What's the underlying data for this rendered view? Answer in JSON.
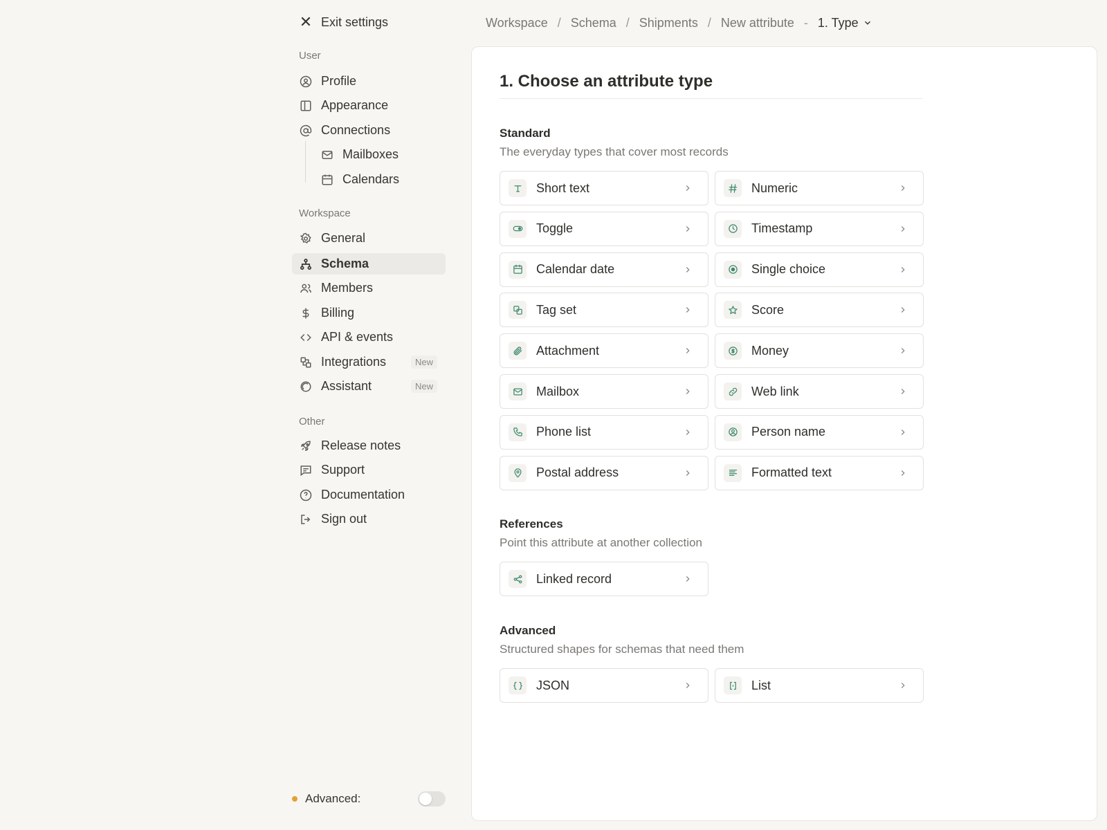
{
  "sidebar": {
    "exit_label": "Exit settings",
    "user_section": "User",
    "workspace_section": "Workspace",
    "other_section": "Other",
    "user_items": [
      {
        "label": "Profile",
        "icon": "user-circle-icon"
      },
      {
        "label": "Appearance",
        "icon": "layout-icon"
      },
      {
        "label": "Connections",
        "icon": "at-sign-icon"
      },
      {
        "label": "Mailboxes",
        "icon": "mail-icon"
      },
      {
        "label": "Calendars",
        "icon": "calendar-icon"
      }
    ],
    "workspace_items": [
      {
        "label": "General",
        "icon": "gear-icon"
      },
      {
        "label": "Schema",
        "icon": "schema-icon",
        "active": true
      },
      {
        "label": "Members",
        "icon": "users-icon"
      },
      {
        "label": "Billing",
        "icon": "dollar-icon"
      },
      {
        "label": "API & events",
        "icon": "code-icon"
      },
      {
        "label": "Integrations",
        "icon": "integrations-icon",
        "badge": "New"
      },
      {
        "label": "Assistant",
        "icon": "assistant-icon",
        "badge": "New"
      }
    ],
    "other_items": [
      {
        "label": "Release notes",
        "icon": "rocket-icon"
      },
      {
        "label": "Support",
        "icon": "message-icon"
      },
      {
        "label": "Documentation",
        "icon": "help-circle-icon"
      },
      {
        "label": "Sign out",
        "icon": "sign-out-icon"
      }
    ],
    "advanced_label": "Advanced:",
    "advanced_enabled": false,
    "advanced_dot_color": "#e3a237"
  },
  "breadcrumb": {
    "items": [
      "Workspace",
      "Schema",
      "Shipments",
      "New attribute"
    ],
    "current": "1. Type"
  },
  "main": {
    "title": "1. Choose an attribute type",
    "standard": {
      "title": "Standard",
      "subtitle": "The everyday types that cover most records",
      "types": [
        {
          "label": "Short text",
          "icon": "text-icon"
        },
        {
          "label": "Numeric",
          "icon": "hash-icon"
        },
        {
          "label": "Toggle",
          "icon": "toggle-icon"
        },
        {
          "label": "Timestamp",
          "icon": "clock-icon"
        },
        {
          "label": "Calendar date",
          "icon": "calendar-icon"
        },
        {
          "label": "Single choice",
          "icon": "radio-icon"
        },
        {
          "label": "Tag set",
          "icon": "tags-icon"
        },
        {
          "label": "Score",
          "icon": "star-icon"
        },
        {
          "label": "Attachment",
          "icon": "paperclip-icon"
        },
        {
          "label": "Money",
          "icon": "currency-icon"
        },
        {
          "label": "Mailbox",
          "icon": "mail-icon"
        },
        {
          "label": "Web link",
          "icon": "link-icon"
        },
        {
          "label": "Phone list",
          "icon": "phone-icon"
        },
        {
          "label": "Person name",
          "icon": "user-circle-icon"
        },
        {
          "label": "Postal address",
          "icon": "map-pin-icon"
        },
        {
          "label": "Formatted text",
          "icon": "align-left-icon"
        }
      ]
    },
    "references": {
      "title": "References",
      "subtitle": "Point this attribute at another collection",
      "types": [
        {
          "label": "Linked record",
          "icon": "share-icon"
        }
      ]
    },
    "advanced": {
      "title": "Advanced",
      "subtitle": "Structured shapes for schemas that need them",
      "types": [
        {
          "label": "JSON",
          "icon": "braces-icon"
        },
        {
          "label": "List",
          "icon": "brackets-icon"
        }
      ]
    },
    "accent_color": "#3d8a6e"
  }
}
